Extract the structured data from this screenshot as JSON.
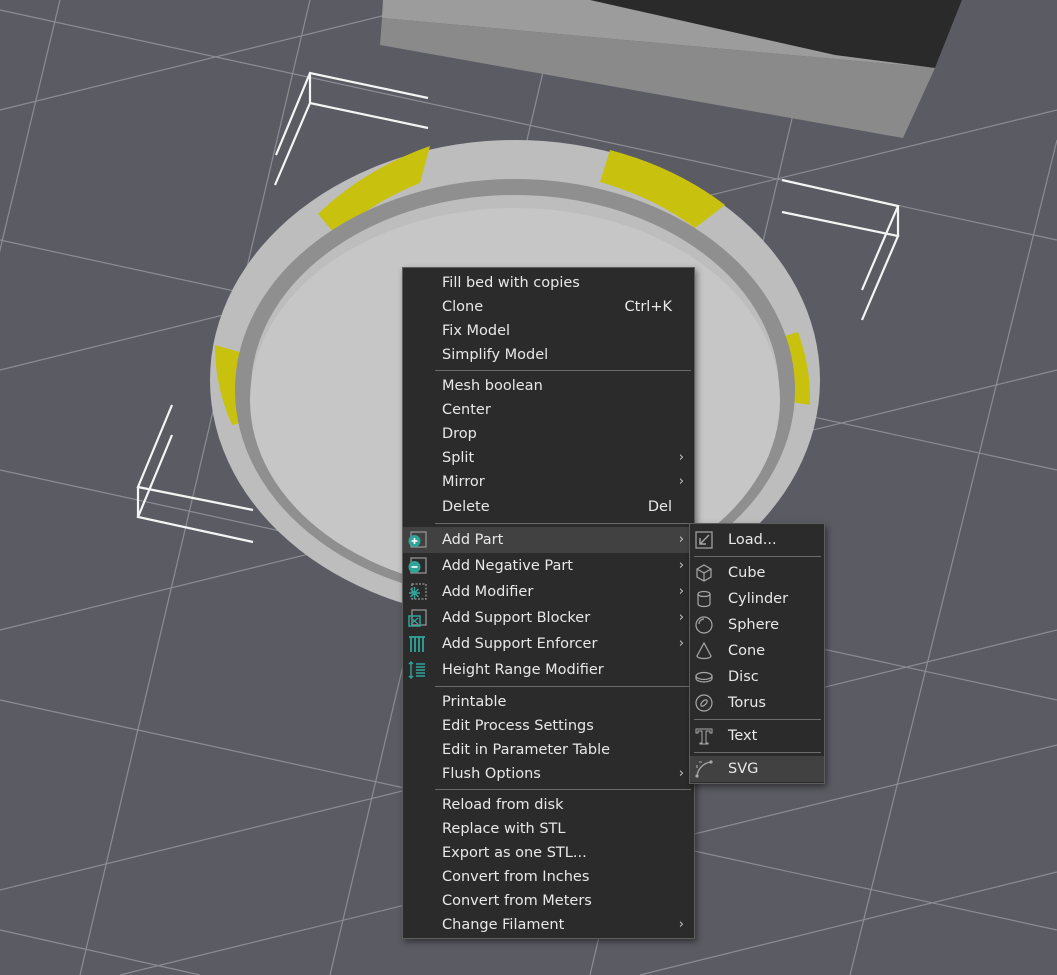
{
  "context_menu": {
    "group1": [
      {
        "label": "Fill bed with copies",
        "shortcut": "",
        "submenu": false
      },
      {
        "label": "Clone",
        "shortcut": "Ctrl+K",
        "submenu": false
      },
      {
        "label": "Fix Model",
        "shortcut": "",
        "submenu": false
      },
      {
        "label": "Simplify Model",
        "shortcut": "",
        "submenu": false
      }
    ],
    "group2": [
      {
        "label": "Mesh boolean",
        "shortcut": "",
        "submenu": false
      },
      {
        "label": "Center",
        "shortcut": "",
        "submenu": false
      },
      {
        "label": "Drop",
        "shortcut": "",
        "submenu": false
      },
      {
        "label": "Split",
        "shortcut": "",
        "submenu": true
      },
      {
        "label": "Mirror",
        "shortcut": "",
        "submenu": true
      },
      {
        "label": "Delete",
        "shortcut": "Del",
        "submenu": false
      }
    ],
    "group3": [
      {
        "label": "Add Part",
        "icon": "add-part-icon",
        "submenu": true,
        "highlighted": true
      },
      {
        "label": "Add Negative Part",
        "icon": "add-negative-part-icon",
        "submenu": true
      },
      {
        "label": "Add Modifier",
        "icon": "add-modifier-icon",
        "submenu": true
      },
      {
        "label": "Add Support Blocker",
        "icon": "support-blocker-icon",
        "submenu": true
      },
      {
        "label": "Add Support Enforcer",
        "icon": "support-enforcer-icon",
        "submenu": true
      },
      {
        "label": "Height Range Modifier",
        "icon": "height-range-icon",
        "submenu": false
      }
    ],
    "group4": [
      {
        "label": "Printable",
        "submenu": false
      },
      {
        "label": "Edit Process Settings",
        "submenu": false
      },
      {
        "label": "Edit in Parameter Table",
        "submenu": false
      },
      {
        "label": "Flush Options",
        "submenu": true
      }
    ],
    "group5": [
      {
        "label": "Reload from disk",
        "submenu": false
      },
      {
        "label": "Replace with STL",
        "submenu": false
      },
      {
        "label": "Export as one STL...",
        "submenu": false
      },
      {
        "label": "Convert from Inches",
        "submenu": false
      },
      {
        "label": "Convert from Meters",
        "submenu": false
      },
      {
        "label": "Change Filament",
        "submenu": true
      }
    ]
  },
  "add_part_submenu": {
    "load": {
      "label": "Load...",
      "icon": "load-icon"
    },
    "shapes": [
      {
        "label": "Cube",
        "icon": "cube-icon"
      },
      {
        "label": "Cylinder",
        "icon": "cylinder-icon"
      },
      {
        "label": "Sphere",
        "icon": "sphere-icon"
      },
      {
        "label": "Cone",
        "icon": "cone-icon"
      },
      {
        "label": "Disc",
        "icon": "disc-icon"
      },
      {
        "label": "Torus",
        "icon": "torus-icon"
      }
    ],
    "text": {
      "label": "Text",
      "icon": "text-icon"
    },
    "svg": {
      "label": "SVG",
      "icon": "svg-icon",
      "highlighted": true
    }
  },
  "symbols": {
    "submenu_arrow": "›"
  },
  "colors": {
    "viewport_bg": "#5b5b63",
    "grid": "#8a8a92",
    "menu_bg": "#2b2b2b",
    "menu_highlight": "#414141",
    "accent_teal": "#2fa59a",
    "model_gray": "#c4c4c4",
    "model_yellow": "#c8c20e"
  }
}
